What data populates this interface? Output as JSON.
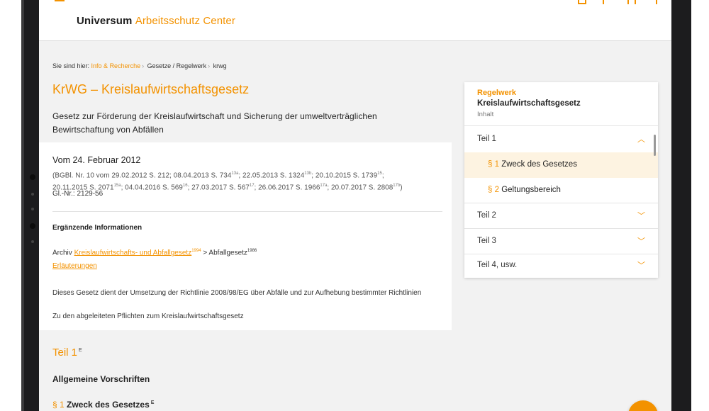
{
  "header": {
    "brand_part1": "Universum",
    "brand_part2": "Arbeitsschutz Center"
  },
  "breadcrumb": {
    "prefix": "Sie sind hier:",
    "link": "Info & Recherche",
    "item2": "Gesetze / Regelwerk",
    "item3": "krwg"
  },
  "title": "KrWG – Kreislaufwirtschaftsgesetz",
  "subtitle": "Gesetz zur Förderung der Kreislaufwirtschaft und Sicherung der umweltverträglichen Bewirtschaftung von Abfällen",
  "info": {
    "date": "Vom 24. Februar 2012",
    "bgbl_line1": "(BGBl. Nr. 10 vom 29.02.2012 S. 212; 08.04.2013 S. 734",
    "sup_13a": "13a",
    "bgbl_b": "; 22.05.2013 S. 1324",
    "sup_13b": "13b",
    "bgbl_c": "; 20.10.2015 S. 1739",
    "sup_15": "15",
    "bgbl_d": ";",
    "bgbl_line2a": "20.11.2015 S. 2071",
    "sup_15a": "15a",
    "bgbl_e": "; 04.04.2016 S. 569",
    "sup_16": "16",
    "bgbl_f": "; 27.03.2017 S. 567",
    "sup_17": "17",
    "bgbl_g": "; 26.06.2017 S. 1966",
    "sup_17a": "17a",
    "bgbl_h": "; 20.07.2017 S. 2808",
    "sup_17b": "17b",
    "bgbl_i": ")",
    "gl": "Gl.-Nr.: 2129-56",
    "erg": "Ergänzende Informationen",
    "archiv_prefix": "Archiv",
    "archiv_link": "Kreislaufwirtschafts- und Abfallgesetz",
    "archiv_link_sup": "1994",
    "archiv_sep": "> Abfallgesetz",
    "archiv_sup2": "1986",
    "erlaeuterungen": "Erläuterungen",
    "dient": "Dieses Gesetz dient der Umsetzung der Richtlinie 2008/98/EG über Abfälle und zur Aufhebung bestimmter Richtlinien",
    "abgeleitet": "Zu den abgeleiteten Pflichten zum Kreislaufwirtschaftsgesetz"
  },
  "content": {
    "teil_head": "Teil 1",
    "teil_sup": "E",
    "allg": "Allgemeine Vorschriften",
    "para_sign": "§ 1",
    "para_title": "Zweck des Gesetzes",
    "para_sup": "E"
  },
  "panel": {
    "label": "Regelwerk",
    "name": "Kreislaufwirtschaftsgesetz",
    "inhalt": "Inhalt",
    "items": [
      {
        "label": "Teil 1",
        "chevron": "^"
      },
      {
        "sign": "§ 1",
        "label": "Zweck des Gesetzes"
      },
      {
        "sign": "§ 2",
        "label": "Geltungsbereich"
      },
      {
        "label": "Teil 2",
        "chevron": "v"
      },
      {
        "label": "Teil 3",
        "chevron": "v"
      },
      {
        "label": "Teil 4, usw.",
        "chevron": "v"
      }
    ]
  },
  "colors": {
    "accent": "#f39200",
    "background": "#f2f2f2",
    "frame": "#1c1c1e"
  }
}
